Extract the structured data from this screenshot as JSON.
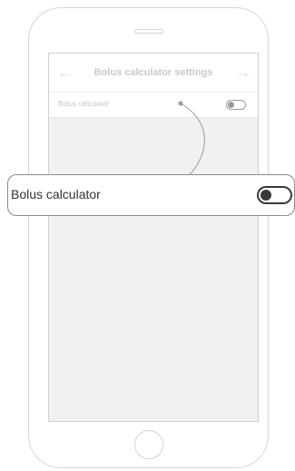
{
  "screen": {
    "header": {
      "title": "Bolus calculator settings",
      "back_icon": "arrow-left-icon",
      "forward_icon": "arrow-right-icon",
      "back_glyph": "←",
      "forward_glyph": "→",
      "accent_color": "#d5e2a8"
    },
    "row": {
      "label": "Bolus calculator",
      "toggle_state": "off"
    }
  },
  "callout": {
    "label": "Bolus calculator",
    "toggle_state": "off"
  }
}
